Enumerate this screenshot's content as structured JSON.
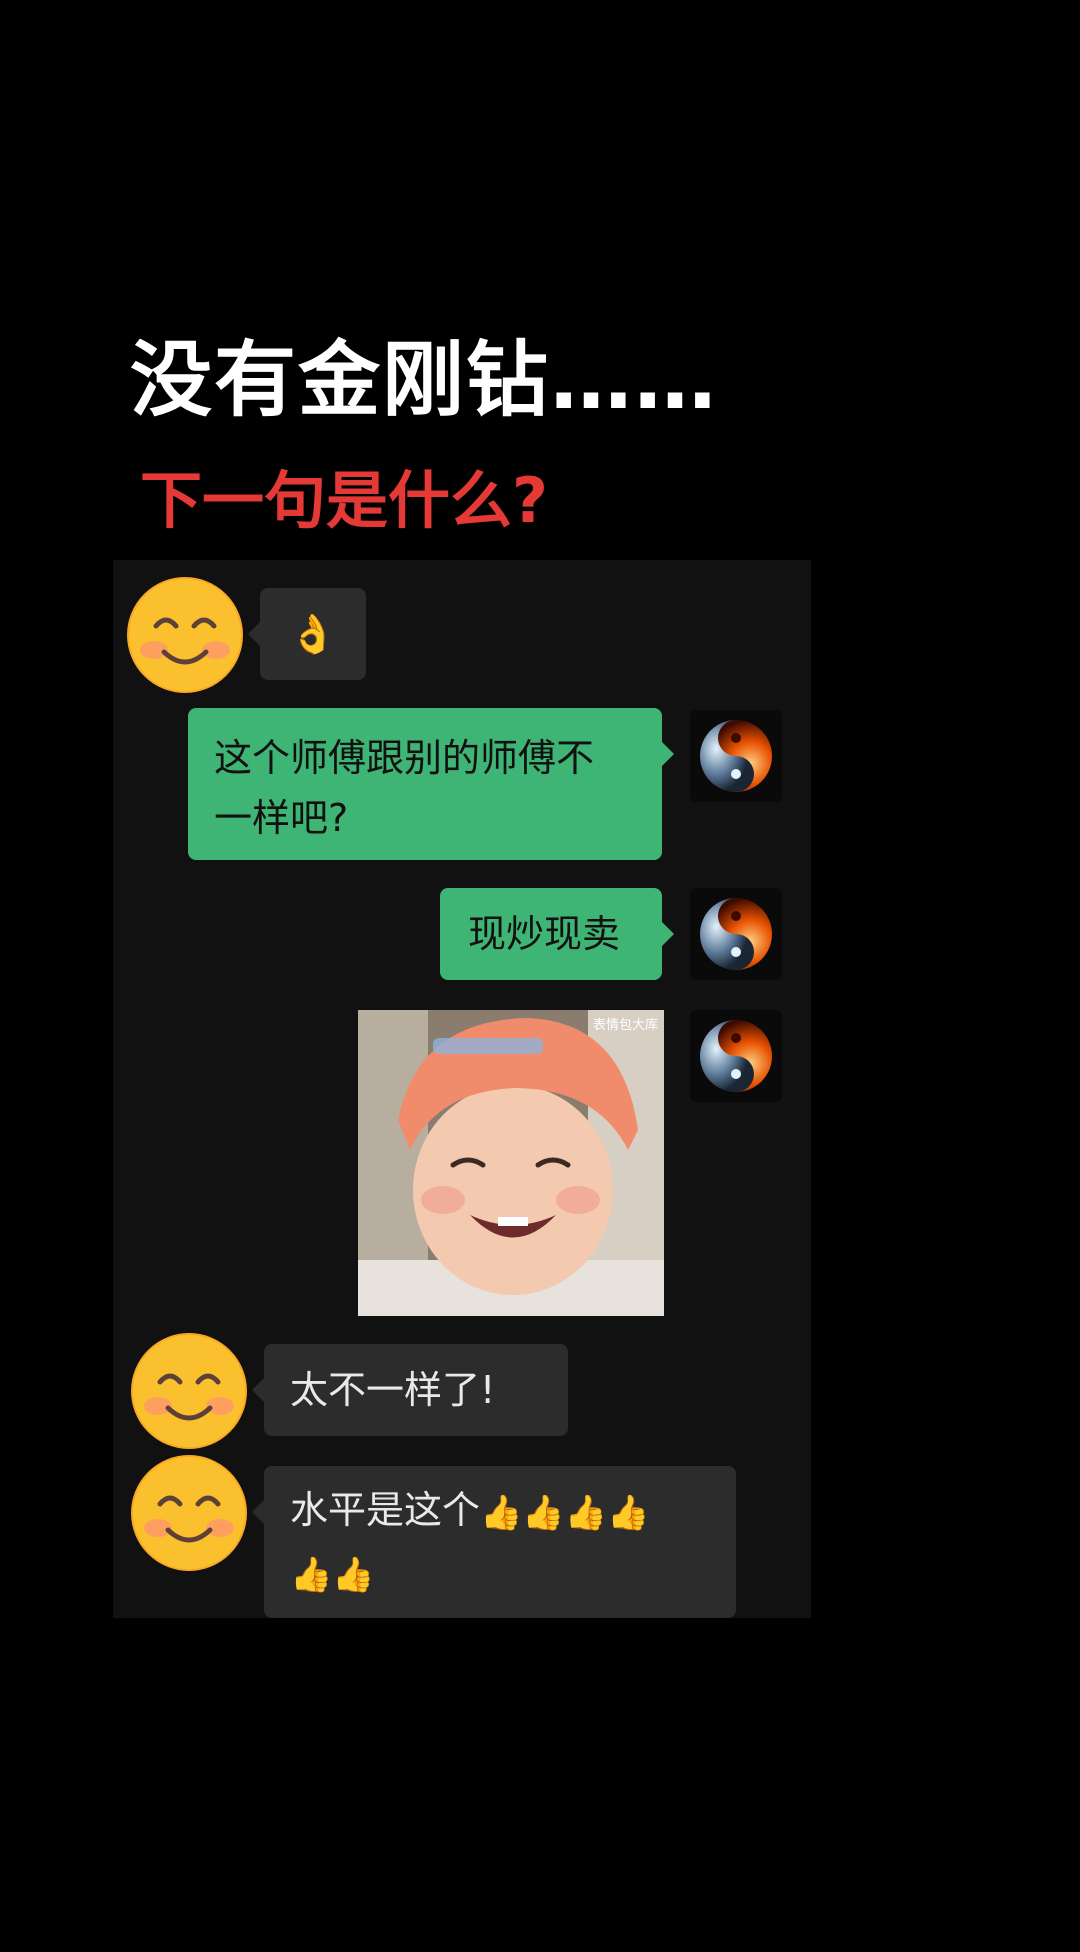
{
  "overlay": {
    "headline": "没有金刚钻……",
    "question": "下一句是什么?"
  },
  "messages": [
    {
      "side": "in",
      "sender_icon": "smiling-face-emoji",
      "text": "👌"
    },
    {
      "side": "out",
      "sender_icon": "yin-yang-fire-ice-avatar",
      "line1": "这个师傅跟别的师傅不",
      "line2": "一样吧?"
    },
    {
      "side": "out",
      "sender_icon": "yin-yang-fire-ice-avatar",
      "text": "现炒现卖"
    },
    {
      "side": "out",
      "sender_icon": "yin-yang-fire-ice-avatar",
      "type": "image",
      "image_watermark": "表情包大库"
    },
    {
      "side": "in",
      "sender_icon": "smiling-face-emoji",
      "text": "太不一样了!"
    },
    {
      "side": "in",
      "sender_icon": "smiling-face-emoji",
      "line1": "水平是这个",
      "line1_emoji": "👍👍👍👍",
      "line2_emoji": "👍👍"
    }
  ],
  "colors": {
    "background": "#000000",
    "panel": "#111111",
    "incoming_bubble": "#2c2c2c",
    "outgoing_bubble": "#3eb575",
    "question_red": "#e53935"
  }
}
